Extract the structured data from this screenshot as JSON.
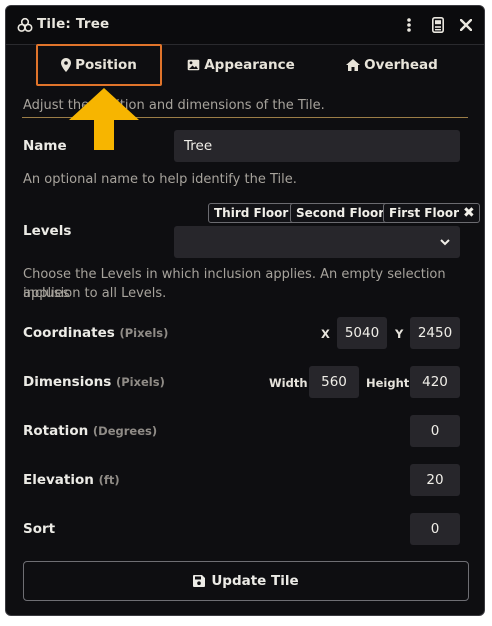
{
  "window": {
    "title": "Tile: Tree"
  },
  "tabs": [
    {
      "label": "Position",
      "icon": "map-pin-icon"
    },
    {
      "label": "Appearance",
      "icon": "image-icon"
    },
    {
      "label": "Overhead",
      "icon": "house-icon"
    }
  ],
  "intro_hint": "Adjust the position and dimensions of the Tile.",
  "name": {
    "label": "Name",
    "value": "Tree",
    "hint": "An optional name to help identify the Tile."
  },
  "levels": {
    "label": "Levels",
    "tags": [
      "Third Floor",
      "Second Floor",
      "First Floor"
    ],
    "hint_line1": "Choose the Levels in which inclusion applies. An empty selection applies",
    "hint_line2": "inclusion to all Levels."
  },
  "coordinates": {
    "label": "Coordinates",
    "unit": "(Pixels)",
    "x_label": "X",
    "x": "5040",
    "y_label": "Y",
    "y": "2450"
  },
  "dimensions": {
    "label": "Dimensions",
    "unit": "(Pixels)",
    "width_label": "Width",
    "width": "560",
    "height_label": "Height",
    "height": "420"
  },
  "rotation": {
    "label": "Rotation",
    "unit": "(Degrees)",
    "value": "0"
  },
  "elevation": {
    "label": "Elevation",
    "unit": "(ft)",
    "value": "20"
  },
  "sort": {
    "label": "Sort",
    "value": "0"
  },
  "update_button": {
    "label": "Update Tile"
  },
  "colors": {
    "highlight": "#e0742b",
    "arrow": "#f7b500",
    "divider": "#9b7d47"
  }
}
